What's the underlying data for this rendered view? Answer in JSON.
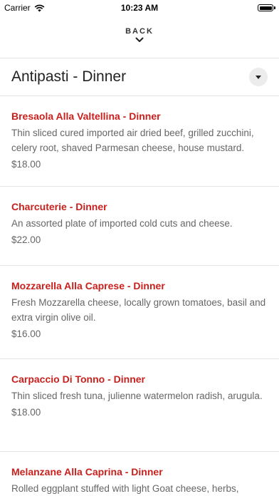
{
  "status_bar": {
    "carrier": "Carrier",
    "time": "10:23 AM"
  },
  "nav": {
    "back_label": "BACK"
  },
  "section": {
    "title": "Antipasti - Dinner"
  },
  "items": [
    {
      "name": "Bresaola Alla Valtellina - Dinner",
      "description": "Thin sliced cured imported air dried beef, grilled zucchini, celery root, shaved Parmesan cheese, house mustard.",
      "price": "$18.00"
    },
    {
      "name": "Charcuterie - Dinner",
      "description": "An assorted plate of imported cold cuts and cheese.",
      "price": "$22.00"
    },
    {
      "name": "Mozzarella Alla Caprese - Dinner",
      "description": "Fresh Mozzarella cheese, locally grown tomatoes, basil and extra virgin olive oil.",
      "price": "$16.00"
    },
    {
      "name": "Carpaccio Di Tonno - Dinner",
      "description": "Thin sliced fresh tuna, julienne watermelon radish, arugula.",
      "price": "$18.00"
    },
    {
      "name": "Melanzane Alla Caprina - Dinner",
      "description": "Rolled eggplant stuffed with light Goat cheese, herbs,",
      "price": ""
    }
  ],
  "colors": {
    "item_name": "#c8211d",
    "text_muted": "#666666",
    "divider": "#e4e4e4"
  }
}
